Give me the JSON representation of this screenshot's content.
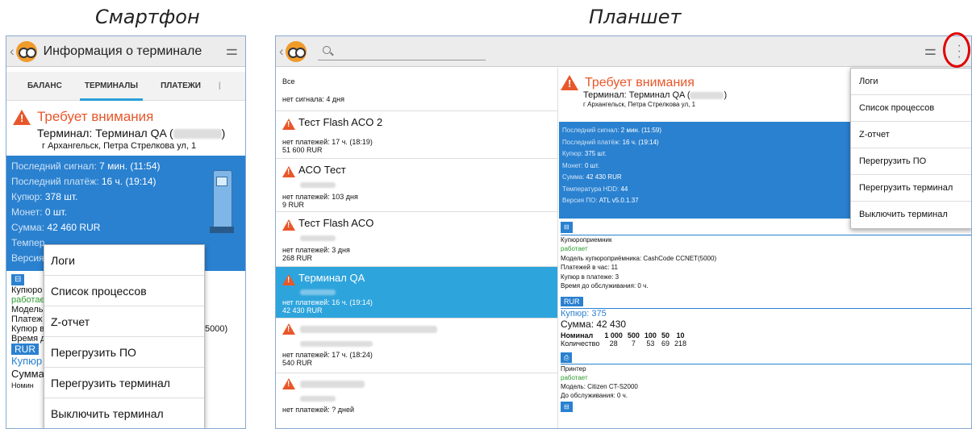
{
  "captions": {
    "phone": "Смартфон",
    "tablet": "Планшет"
  },
  "phone": {
    "title": "Информация о терминале",
    "tabs": [
      "БАЛАНС",
      "ТЕРМИНАЛЫ",
      "ПЛАТЕЖИ"
    ],
    "alert_title": "Требует внимания",
    "terminal_prefix": "Терминал: Терминал QA (",
    "terminal_suffix": ")",
    "address": "г Архангельск, Петра Стрелкова ул, 1",
    "info": {
      "last_signal_label": "Последний сигнал:",
      "last_signal": "7 мин. (11:54)",
      "last_payment_label": "Последний платёж:",
      "last_payment": "16 ч. (19:14)",
      "bills_label": "Купюр:",
      "bills": "378 шт.",
      "coins_label": "Монет:",
      "coins": "0 шт.",
      "sum_label": "Сумма:",
      "sum": "42 460 RUR",
      "temp_label": "Темпер",
      "version_label": "Версия"
    },
    "below": {
      "line1": "Купюро",
      "line2": "работае",
      "line3": "Модель",
      "line4": "Платеж",
      "line5": "Купюр в",
      "line6": "Время д",
      "rur": "RUR",
      "bills": "Купюр",
      "sum": "Сумма",
      "nominal": "Номин",
      "model_tail": "5000)"
    },
    "menu": [
      "Логи",
      "Список процессов",
      "Z-отчет",
      "Перегрузить ПО",
      "Перегрузить терминал",
      "Выключить терминал"
    ]
  },
  "tablet": {
    "search_icon": "search-icon",
    "list": {
      "all": "Все",
      "no_signal": "нет сигнала: 4 дня",
      "items": [
        {
          "name": "Тест Flash ACO 2",
          "line1": "нет платежей: 17 ч. (18:19)",
          "line2": "51 600 RUR"
        },
        {
          "name": "ACO Тест",
          "line1": "нет платежей: 103 дня",
          "line2": "9 RUR"
        },
        {
          "name": "Тест Flash ACO",
          "line1": "нет платежей: 3 дня",
          "line2": "268 RUR"
        },
        {
          "name": "Терминал QA",
          "line1": "нет платежей: 16 ч. (19:14)",
          "line2": "42 430 RUR"
        },
        {
          "name": "",
          "line1": "нет платежей: 17 ч. (18:24)",
          "line2": "540 RUR"
        },
        {
          "name": "",
          "line1": "нет платежей: ? дней",
          "line2": ""
        }
      ]
    },
    "detail": {
      "alert_title": "Требует внимания",
      "terminal_prefix": "Терминал: Терминал QA (",
      "terminal_suffix": ")",
      "address": "г Архангельск, Петра Стрелкова ул, 1",
      "info": {
        "last_signal_label": "Последний сигнал:",
        "last_signal": "2 мин. (11:59)",
        "last_payment_label": "Последний платёж:",
        "last_payment": "16 ч. (19:14)",
        "bills_label": "Купюр:",
        "bills": "375 шт.",
        "coins_label": "Монет:",
        "coins": "0 шт.",
        "sum_label": "Сумма:",
        "sum": "42 430 RUR",
        "temp_label": "Температура HDD:",
        "temp": "44",
        "version_label": "Версия ПО:",
        "version": "ATL v5.0.1.37"
      },
      "acceptor": {
        "title": "Купюроприемник",
        "status": "работает",
        "model": "Модель купюроприёмника: CashCode CCNET(5000)",
        "per_hour": "Платежей в час: 11",
        "per_payment": "Купюр в платеже: 3",
        "service": "Время до обслуживания: 0 ч."
      },
      "cash": {
        "currency": "RUR",
        "bills": "Купюр: 375",
        "sum": "Сумма: 42 430",
        "table": [
          [
            "Номинал",
            "1 000",
            "500",
            "100",
            "50",
            "10"
          ],
          [
            "Количество",
            "28",
            "7",
            "53",
            "69",
            "218"
          ]
        ]
      },
      "printer": {
        "title": "Принтер",
        "status": "работает",
        "model": "Модель: Citizen CT-S2000",
        "service": "До обслуживания: 0 ч."
      }
    },
    "menu": [
      "Логи",
      "Список процессов",
      "Z-отчет",
      "Перегрузить ПО",
      "Перегрузить терминал",
      "Выключить терминал"
    ]
  },
  "colors": {
    "accent_blue": "#2a81d0",
    "selected_blue": "#2ea4dc",
    "alert_orange": "#e8572a",
    "highlight_red": "#e00000"
  }
}
